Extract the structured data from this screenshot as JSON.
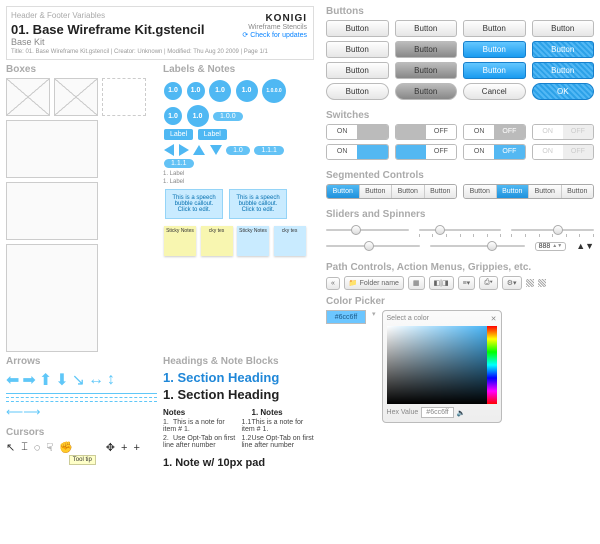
{
  "header": {
    "caption": "Header & Footer Variables",
    "title": "01. Base Wireframe Kit.gstencil",
    "subtitle": "Base Kit",
    "logo": "KONIGI",
    "logo_sub": "Wireframe Stencils",
    "check": "Check for updates",
    "meta": "Title: 01. Base Wireframe Kit.gstencil  |  Creator: Unknown  |  Modified: Thu Aug 20 2009  |  Page 1/1"
  },
  "sections": {
    "boxes": "Boxes",
    "labels": "Labels & Notes",
    "arrows": "Arrows",
    "cursors": "Cursors",
    "headings": "Headings & Note Blocks",
    "buttons": "Buttons",
    "switches": "Switches",
    "segmented": "Segmented Controls",
    "sliders": "Sliders and Spinners",
    "path": "Path Controls, Action Menus, Grippies, etc.",
    "color": "Color Picker"
  },
  "labels": {
    "circ": [
      "1.0",
      "1.0",
      "1.0",
      "1.0",
      "1.0.0.0"
    ],
    "pill": "1.0.0",
    "leaders": [
      "1.0",
      "1.1.1",
      "1.1.1"
    ],
    "rect": [
      "Label",
      "Label"
    ],
    "txt": "1. Label",
    "speech": "This is a speech bubble callout. Click to edit.",
    "sticky": "Sticky Notes"
  },
  "headings": {
    "h1": "1. Section Heading",
    "h2": "1. Section Heading",
    "notes": "Notes",
    "n1": "1.",
    "n1t": "This is a note for item # 1.",
    "n2": "2.",
    "n2t": "Use Opt-Tab on first line after number",
    "n1a": "1.1",
    "n1b": "1.2",
    "pad": "1.  Note w/ 10px pad"
  },
  "buttons": {
    "b": "Button",
    "cancel": "Cancel",
    "ok": "OK"
  },
  "switches": {
    "on": "ON",
    "off": "OFF"
  },
  "segmented": {
    "b": "Button"
  },
  "spinner": "888",
  "path": {
    "folder": "Folder name",
    "left": "«"
  },
  "picker": {
    "hex": "#6cc6ff",
    "hv": "Hex Value",
    "sel": "Select a color"
  },
  "tooltip": "Tool tip"
}
